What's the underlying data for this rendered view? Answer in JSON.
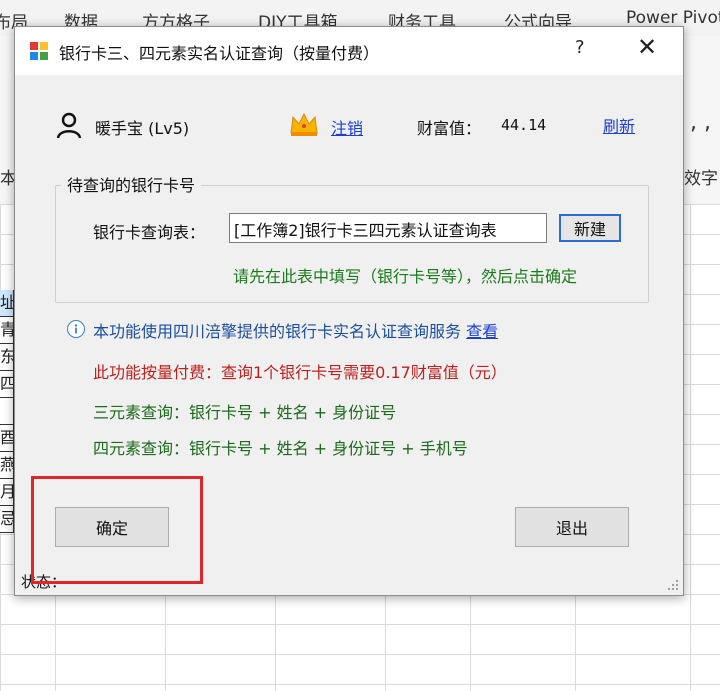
{
  "excel": {
    "ribbon_tabs": [
      "布局",
      "数据",
      "方方格子",
      "DIY工具箱",
      "财务工具",
      "公式向导",
      "Power Pivot"
    ],
    "left_cells": [
      "址",
      "青",
      "东",
      "四",
      "",
      "酉",
      "燕",
      "月",
      "忌"
    ],
    "right_fragment_1": ", ,",
    "right_fragment_2": "效字"
  },
  "dialog": {
    "title": "银行卡三、四元素实名认证查询（按量付费）",
    "help": "?",
    "close": "✕"
  },
  "user": {
    "name": "暖手宝 (Lv5)",
    "logout": "注销",
    "wealth_label": "财富值：",
    "wealth_value": "44.14",
    "refresh": "刷新"
  },
  "query_group": {
    "title": "待查询的银行卡号",
    "table_label": "银行卡查询表：",
    "table_value": "[工作簿2]银行卡三四元素认证查询表",
    "new_button": "新建",
    "hint": "请先在此表中填写（银行卡号等），然后点击确定"
  },
  "info": {
    "service_text": "本功能使用四川涪擎提供的银行卡实名认证查询服务",
    "view_link": "查看",
    "fee_text": "此功能按量付费：查询1个银行卡号需要0.17财富值（元）",
    "three_element": "三元素查询：银行卡号 + 姓名 + 身份证号",
    "four_element": "四元素查询：银行卡号 + 姓名 + 身份证号 + 手机号"
  },
  "buttons": {
    "ok": "确定",
    "exit": "退出"
  },
  "status": {
    "label": "状态："
  },
  "colors": {
    "link": "#1a3fd8",
    "hint_green": "#1c7a1c",
    "fee_red": "#c0211d",
    "highlight": "#e0262a",
    "dialog_bg": "#f0f0f0"
  }
}
